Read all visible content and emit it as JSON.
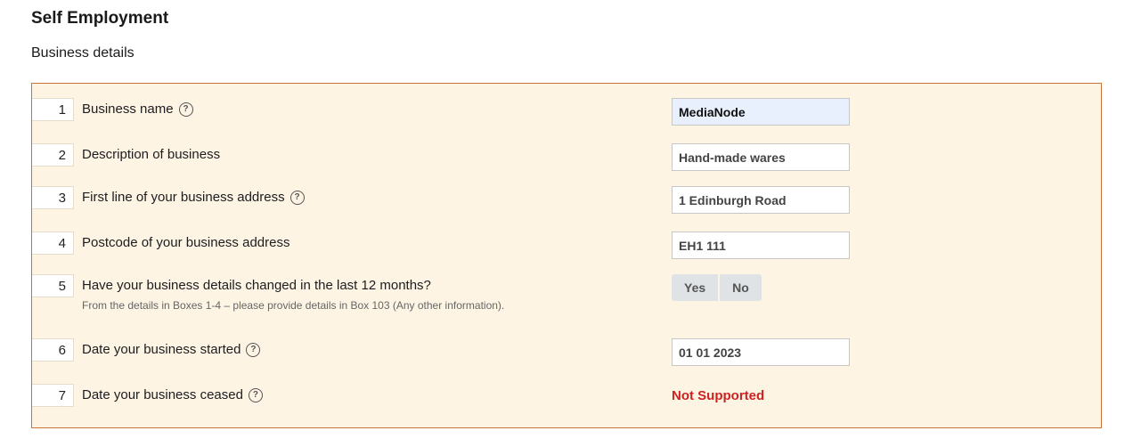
{
  "page": {
    "title": "Self Employment",
    "section_title": "Business details"
  },
  "rows": [
    {
      "number": "1",
      "label": "Business name",
      "value": "MediaNode"
    },
    {
      "number": "2",
      "label": "Description of business",
      "value": "Hand-made wares"
    },
    {
      "number": "3",
      "label": "First line of your business address",
      "value": "1 Edinburgh Road"
    },
    {
      "number": "4",
      "label": "Postcode of your business address",
      "value": "EH1 111"
    },
    {
      "number": "5",
      "label": "Have your business details changed in the last 12 months?",
      "sublabel": "From the details in Boxes 1-4 – please provide details in Box 103 (Any other information).",
      "options": [
        "Yes",
        "No"
      ]
    },
    {
      "number": "6",
      "label": "Date your business started",
      "value": "01 01 2023"
    },
    {
      "number": "7",
      "label": "Date your business ceased",
      "value": "Not Supported"
    }
  ],
  "help_glyph": "?",
  "colors": {
    "panel_bg": "#fdf4e4",
    "panel_border": "#c9733a",
    "error": "#cc2222",
    "active_field": "#e8f0fe"
  }
}
